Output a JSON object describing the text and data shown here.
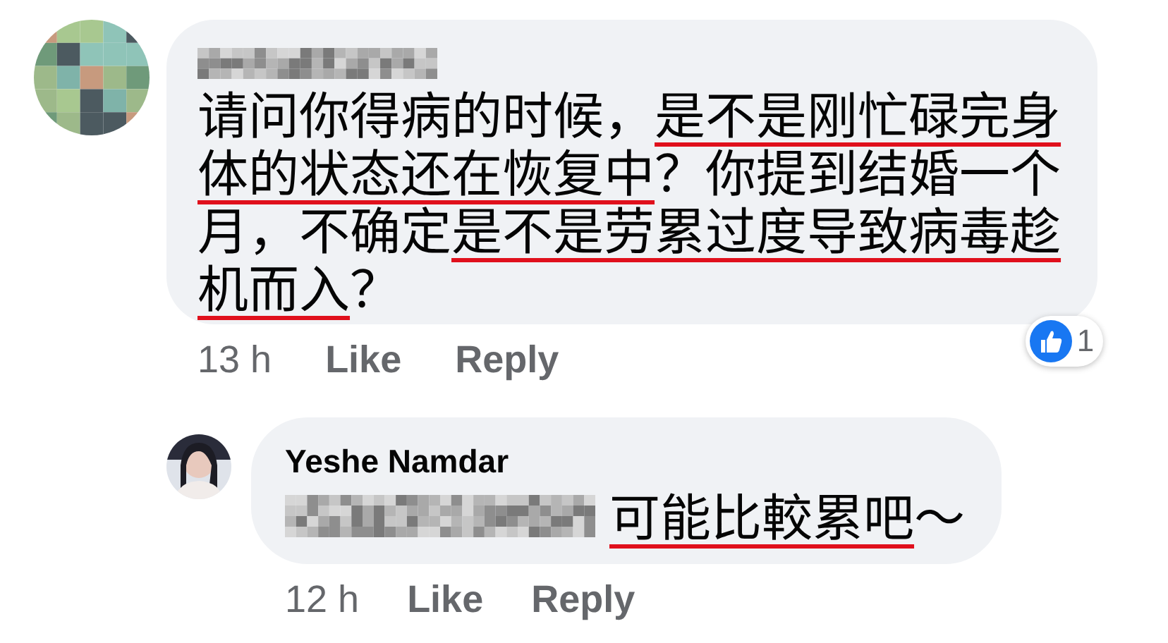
{
  "comments": [
    {
      "body": [
        {
          "text": "请问你得病的时候，",
          "underlined": false
        },
        {
          "text": "是不是刚忙碌完身体的状态还在恢复中",
          "underlined": true
        },
        {
          "text": "？你提到结婚一个月，不确定",
          "underlined": false
        },
        {
          "text": "是不是劳累过度导致病毒趁机而入",
          "underlined": true
        },
        {
          "text": "？",
          "underlined": false
        }
      ],
      "time": "13 h",
      "actions": [
        "Like",
        "Reply"
      ],
      "reaction": {
        "count": "1"
      },
      "replies": [
        {
          "author": "Yeshe Namdar",
          "body": [
            {
              "text": "可能比較累吧",
              "underlined": true
            },
            {
              "text": "～",
              "underlined": false
            }
          ],
          "time": "12 h",
          "actions": [
            "Like",
            "Reply"
          ]
        }
      ]
    }
  ]
}
